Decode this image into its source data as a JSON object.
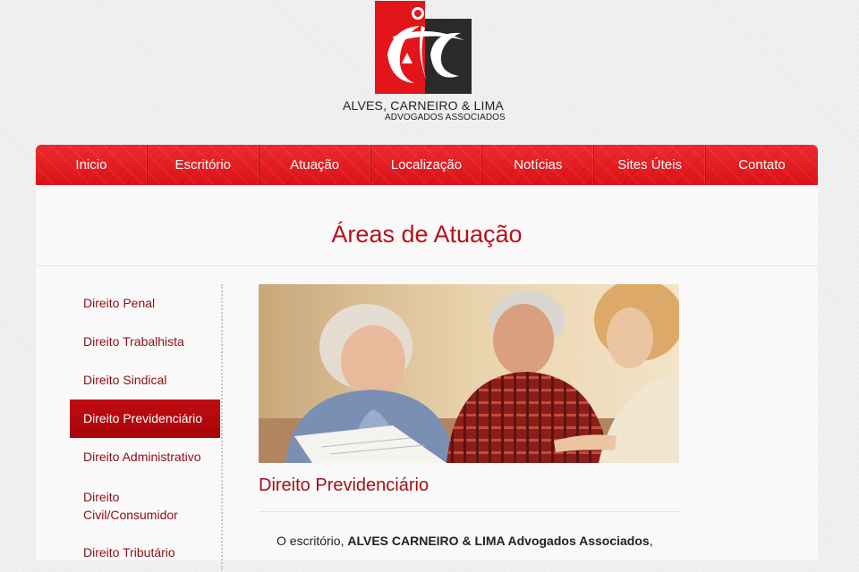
{
  "logo": {
    "name": "ALVES, CARNEIRO & LIMA",
    "subtitle": "ADVOGADOS ASSOCIADOS",
    "colors": {
      "red": "#e3151b",
      "dark": "#222222"
    }
  },
  "nav": {
    "items": [
      {
        "label": "Inicio"
      },
      {
        "label": "Escritório"
      },
      {
        "label": "Atuação"
      },
      {
        "label": "Localização"
      },
      {
        "label": "Notícias"
      },
      {
        "label": "Sites Úteis"
      },
      {
        "label": "Contato"
      }
    ]
  },
  "page": {
    "title": "Áreas de Atuação"
  },
  "sidebar": {
    "items": [
      {
        "label": "Direito Penal"
      },
      {
        "label": "Direito Trabalhista"
      },
      {
        "label": "Direito Sindical"
      },
      {
        "label": "Direito Previdenciário"
      },
      {
        "label": "Direito Administrativo"
      },
      {
        "label": "Direito Civil/Consumidor"
      },
      {
        "label": "Direito Tributário"
      }
    ],
    "active_index": 3
  },
  "content": {
    "title": "Direito Previdenciário",
    "text_prefix": "O escritório,",
    "text_bold": "ALVES CARNEIRO & LIMA Advogados Associados",
    "text_suffix": ","
  },
  "colors": {
    "accent": "#b5121b",
    "nav": "#e3151b",
    "active": "#b3070c"
  }
}
